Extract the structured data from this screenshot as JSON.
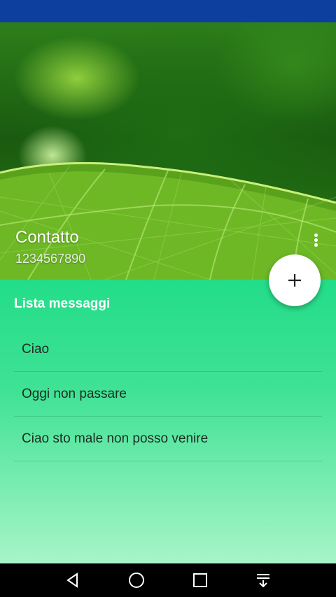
{
  "header": {
    "contact_name": "Contatto",
    "contact_number": "1234567890",
    "menu_icon": "more-vert-icon"
  },
  "fab": {
    "icon": "plus-icon"
  },
  "messages": {
    "title": "Lista messaggi",
    "items": [
      {
        "text": "Ciao"
      },
      {
        "text": "Oggi non passare"
      },
      {
        "text": "Ciao sto male non posso venire"
      }
    ]
  },
  "nav": {
    "back_icon": "back-triangle-icon",
    "home_icon": "home-circle-icon",
    "recents_icon": "recents-square-icon",
    "notifications_icon": "pull-down-icon"
  },
  "colors": {
    "status_bar": "#0d3f9e",
    "content_top": "#22dd88",
    "content_bottom": "#a7f4c8"
  }
}
